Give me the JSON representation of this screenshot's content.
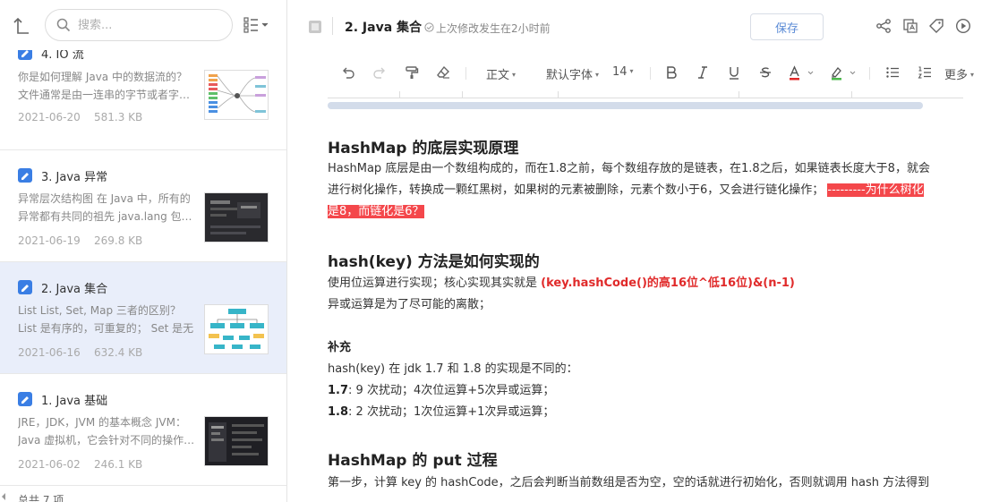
{
  "search": {
    "placeholder": "搜索..."
  },
  "notes": [
    {
      "title": "4. IO 流",
      "summary": "你是如何理解 Java 中的数据流的？文件通常是由一连串的字节或者字…",
      "date": "2021-06-20",
      "size": "581.3 KB",
      "thumb": "mindmap"
    },
    {
      "title": "3. Java 异常",
      "summary": "异常层次结构图 在 Java 中，所有的异常都有共同的祖先 java.lang 包…",
      "date": "2021-06-19",
      "size": "269.8 KB",
      "thumb": "dark"
    },
    {
      "title": "2. Java 集合",
      "summary": "List List, Set, Map 三者的区别？ List 是有序的，可重复的； Set 是无序…",
      "date": "2021-06-16",
      "size": "632.4 KB",
      "thumb": "diagram",
      "active": true
    },
    {
      "title": "1. Java 基础",
      "summary": "JRE，JDK，JVM 的基本概念 JVM：Java 虚拟机，它会针对不同的操作…",
      "date": "2021-06-02",
      "size": "246.1 KB",
      "thumb": "dark"
    }
  ],
  "list_footer": "总共 7 项",
  "editor": {
    "title": "2. Java 集合",
    "modified": "上次修改发生在2小时前",
    "save_label": "保存",
    "toolbar": {
      "paragraph": "正文",
      "font": "默认字体",
      "size": "14",
      "more": "更多"
    }
  },
  "article": {
    "h1": "HashMap 的底层实现原理",
    "p1_line1": "HashMap 底层是由一个数组构成的，而在1.8之前，每个数组存放的是链表，在1.8之后，如果链表长度大于8，就会",
    "p1_line2_pre": "进行树化操作，转换成一颗红黑树，如果树的元素被删除，元素个数小于6，又会进行链化操作；",
    "p1_hl1": "---------为什么树化",
    "p1_hl2": "是8，而链化是6？",
    "h2": "hash(key) 方法是如何实现的",
    "p2_pre": "使用位运算进行实现；核心实现其实就是",
    "p2_red": "(key.hashCode()的高16位^低16位)&(n-1)",
    "p3": "异或运算是为了尽可能的离散；",
    "supp_title": "补充",
    "supp_intro": "hash(key) 在 jdk 1.7 和 1.8 的实现是不同的：",
    "supp_17_label": "1.7",
    "supp_17": ": 9 次扰动；4次位运算+5次异或运算；",
    "supp_18_label": "1.8",
    "supp_18": ": 2 次扰动；1次位运算+1次异或运算；",
    "h3": "HashMap 的 put 过程",
    "p4": "第一步，计算 key 的 hashCode，之后会判断当前数组是否为空，空的话就进行初始化，否则就调用 hash 方法得到"
  },
  "colors": {
    "accent": "#3a7ee4",
    "active_bg": "#e9eefa",
    "highlight": "#f4474b",
    "red_text": "#e02a2a"
  }
}
